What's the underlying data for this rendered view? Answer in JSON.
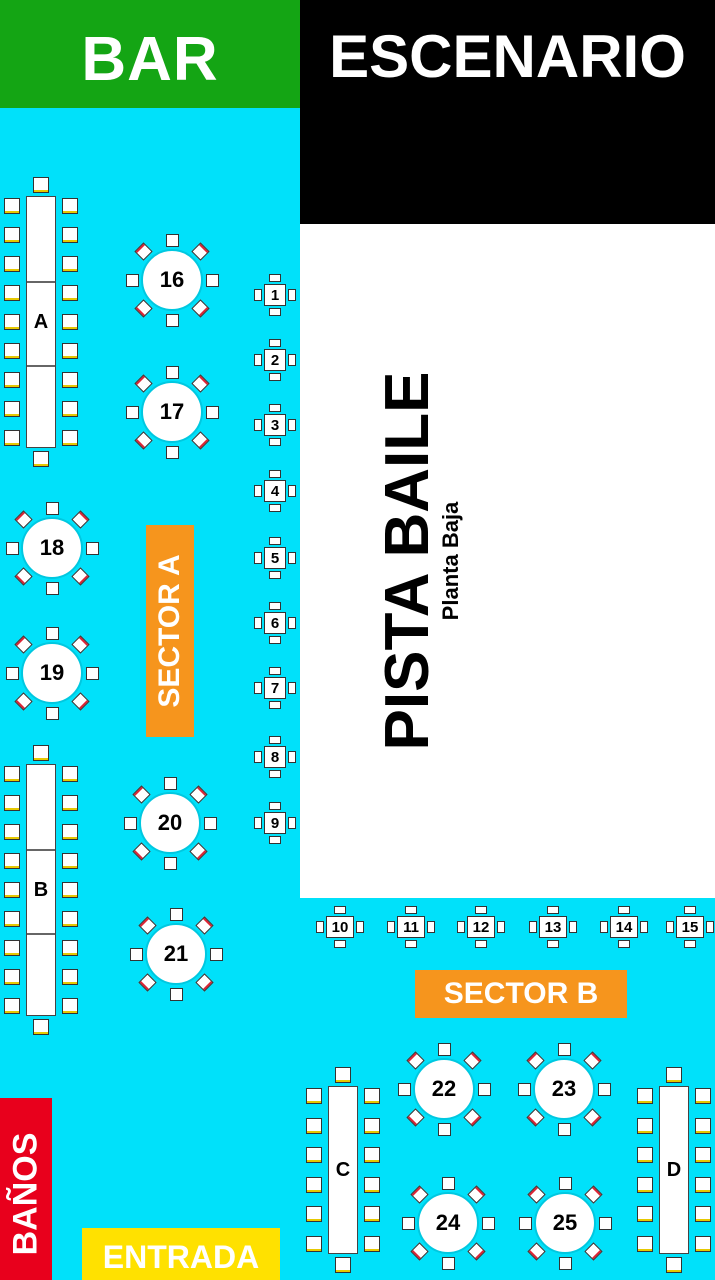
{
  "zones": {
    "bar": "BAR",
    "escenario": "ESCENARIO",
    "pista_title": "PISTA BAILE",
    "pista_subtitle": "Planta Baja",
    "sector_a": "SECTOR A",
    "sector_b": "SECTOR B",
    "banos": "BAÑOS",
    "entrada": "ENTRADA"
  },
  "long_tables": [
    "A",
    "B",
    "C",
    "D"
  ],
  "round_tables": [
    "16",
    "17",
    "18",
    "19",
    "20",
    "21",
    "22",
    "23",
    "24",
    "25"
  ],
  "small_tables": [
    "1",
    "2",
    "3",
    "4",
    "5",
    "6",
    "7",
    "8",
    "9",
    "10",
    "11",
    "12",
    "13",
    "14",
    "15"
  ],
  "colors": {
    "floor": "#00e1fa",
    "bar": "#14a514",
    "stage": "#000000",
    "banos": "#e8001c",
    "entrada": "#ffe100",
    "sector": "#f6951d"
  }
}
